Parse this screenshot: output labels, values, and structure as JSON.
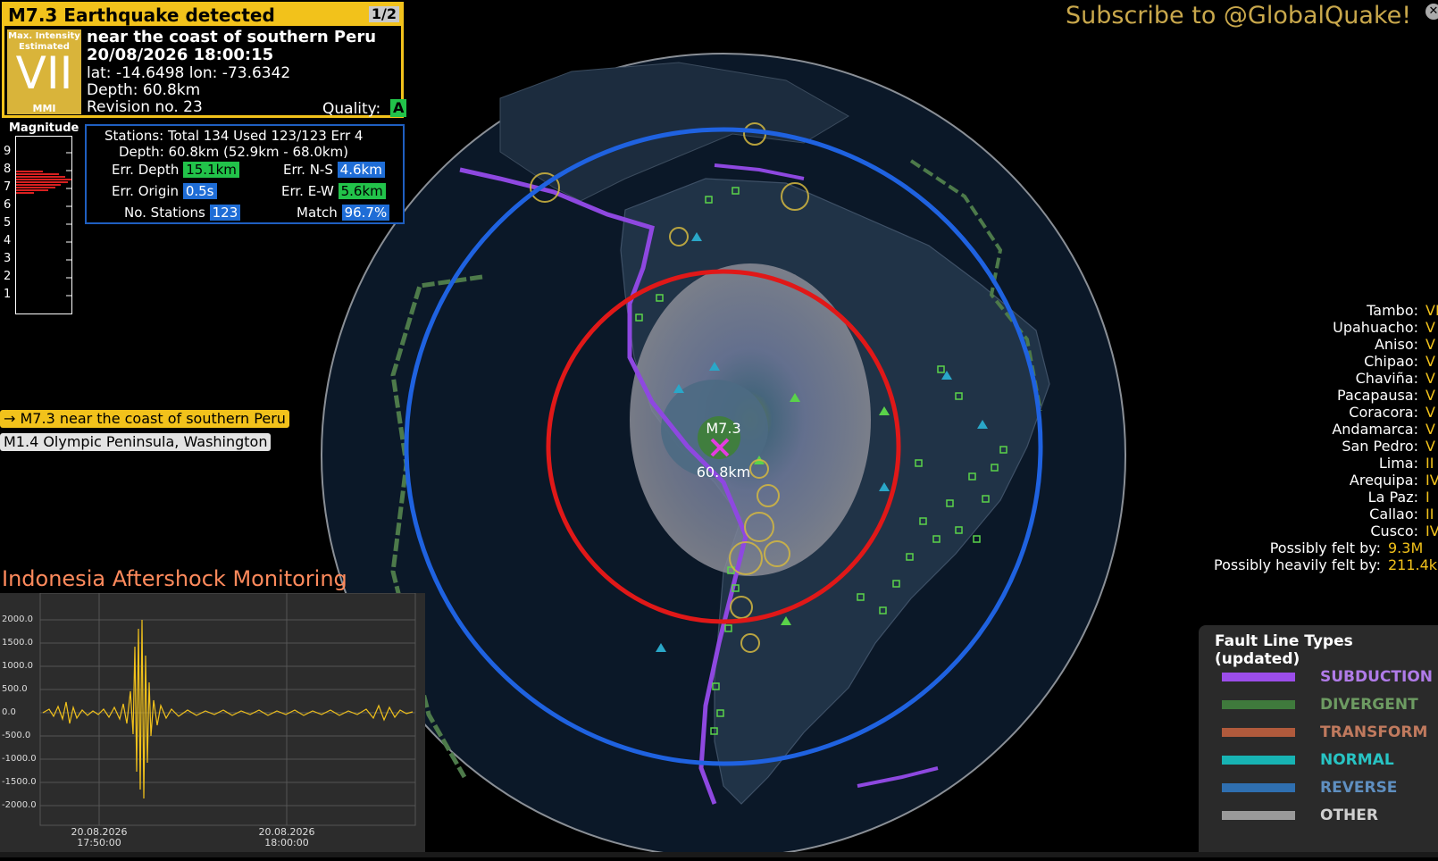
{
  "alert": {
    "title": "M7.3 Earthquake detected",
    "page": "1/2",
    "mmi_label": "Max. Intensity Estimated",
    "mmi_value": "VII",
    "mmi_unit": "MMI",
    "region": "near the coast of southern Peru",
    "datetime": "20/08/2026 18:00:15",
    "coords": "lat: -14.6498 lon: -73.6342",
    "depth": "Depth: 60.8km",
    "revision": "Revision no. 23",
    "quality_label": "Quality:",
    "quality_value": "A"
  },
  "magnitude_hist": {
    "title": "Magnitude",
    "ticks": [
      "9",
      "8",
      "7",
      "6",
      "5",
      "4",
      "3",
      "2",
      "1"
    ]
  },
  "stats": {
    "stations": "Stations: Total 134 Used 123/123 Err 4",
    "depth_range": "Depth: 60.8km (52.9km - 68.0km)",
    "err_depth_label": "Err. Depth",
    "err_depth": "15.1km",
    "err_ns_label": "Err. N-S",
    "err_ns": "4.6km",
    "err_origin_label": "Err. Origin",
    "err_origin": "0.5s",
    "err_ew_label": "Err. E-W",
    "err_ew": "5.6km",
    "no_stations_label": "No. Stations",
    "no_stations": "123",
    "match_label": "Match",
    "match": "96.7%"
  },
  "events": [
    "→ M7.3 near the coast of southern Peru",
    "M1.4 Olympic Peninsula, Washington"
  ],
  "epicenter": {
    "magnitude": "M7.3",
    "depth": "60.8km"
  },
  "seismogram": {
    "title": "Indonesia Aftershock Monitoring",
    "y_ticks": [
      "2000.0",
      "1500.0",
      "1000.0",
      "500.0",
      "0.0",
      "-500.0",
      "-1000.0",
      "-1500.0",
      "-2000.0"
    ],
    "x_ticks": [
      [
        "20.08.2026",
        "17:50:00"
      ],
      [
        "20.08.2026",
        "18:00:00"
      ]
    ]
  },
  "subscribe": "Subscribe to @GlobalQuake!",
  "intensity_list": [
    {
      "name": "Tambo:",
      "val": "VI"
    },
    {
      "name": "Upahuacho:",
      "val": "V"
    },
    {
      "name": "Aniso:",
      "val": "V"
    },
    {
      "name": "Chipao:",
      "val": "V"
    },
    {
      "name": "Chaviña:",
      "val": "V"
    },
    {
      "name": "Pacapausa:",
      "val": "V"
    },
    {
      "name": "Coracora:",
      "val": "V"
    },
    {
      "name": "Andamarca:",
      "val": "V"
    },
    {
      "name": "San Pedro:",
      "val": "V"
    },
    {
      "name": "Lima:",
      "val": "II"
    },
    {
      "name": "Arequipa:",
      "val": "IV"
    },
    {
      "name": "La Paz:",
      "val": "I"
    },
    {
      "name": "Callao:",
      "val": "II"
    },
    {
      "name": "Cusco:",
      "val": "IV"
    },
    {
      "name": "Possibly felt by:",
      "val": "9.3M"
    },
    {
      "name": "Possibly heavily felt by:",
      "val": "211.4k"
    }
  ],
  "legend": {
    "title": "Fault Line Types (updated)",
    "items": [
      {
        "label": "SUBDUCTION",
        "color": "#9b4dea",
        "text_color": "#b07be8"
      },
      {
        "label": "DIVERGENT",
        "color": "#3f7a3c",
        "text_color": "#6d9b62"
      },
      {
        "label": "TRANSFORM",
        "color": "#b05a3c",
        "text_color": "#c07a5e"
      },
      {
        "label": "NORMAL",
        "color": "#17b3b3",
        "text_color": "#28c4c4"
      },
      {
        "label": "REVERSE",
        "color": "#2f6fb0",
        "text_color": "#5f8fc0"
      },
      {
        "label": "OTHER",
        "color": "#9a9a9a",
        "text_color": "#d0d0d0"
      }
    ]
  }
}
